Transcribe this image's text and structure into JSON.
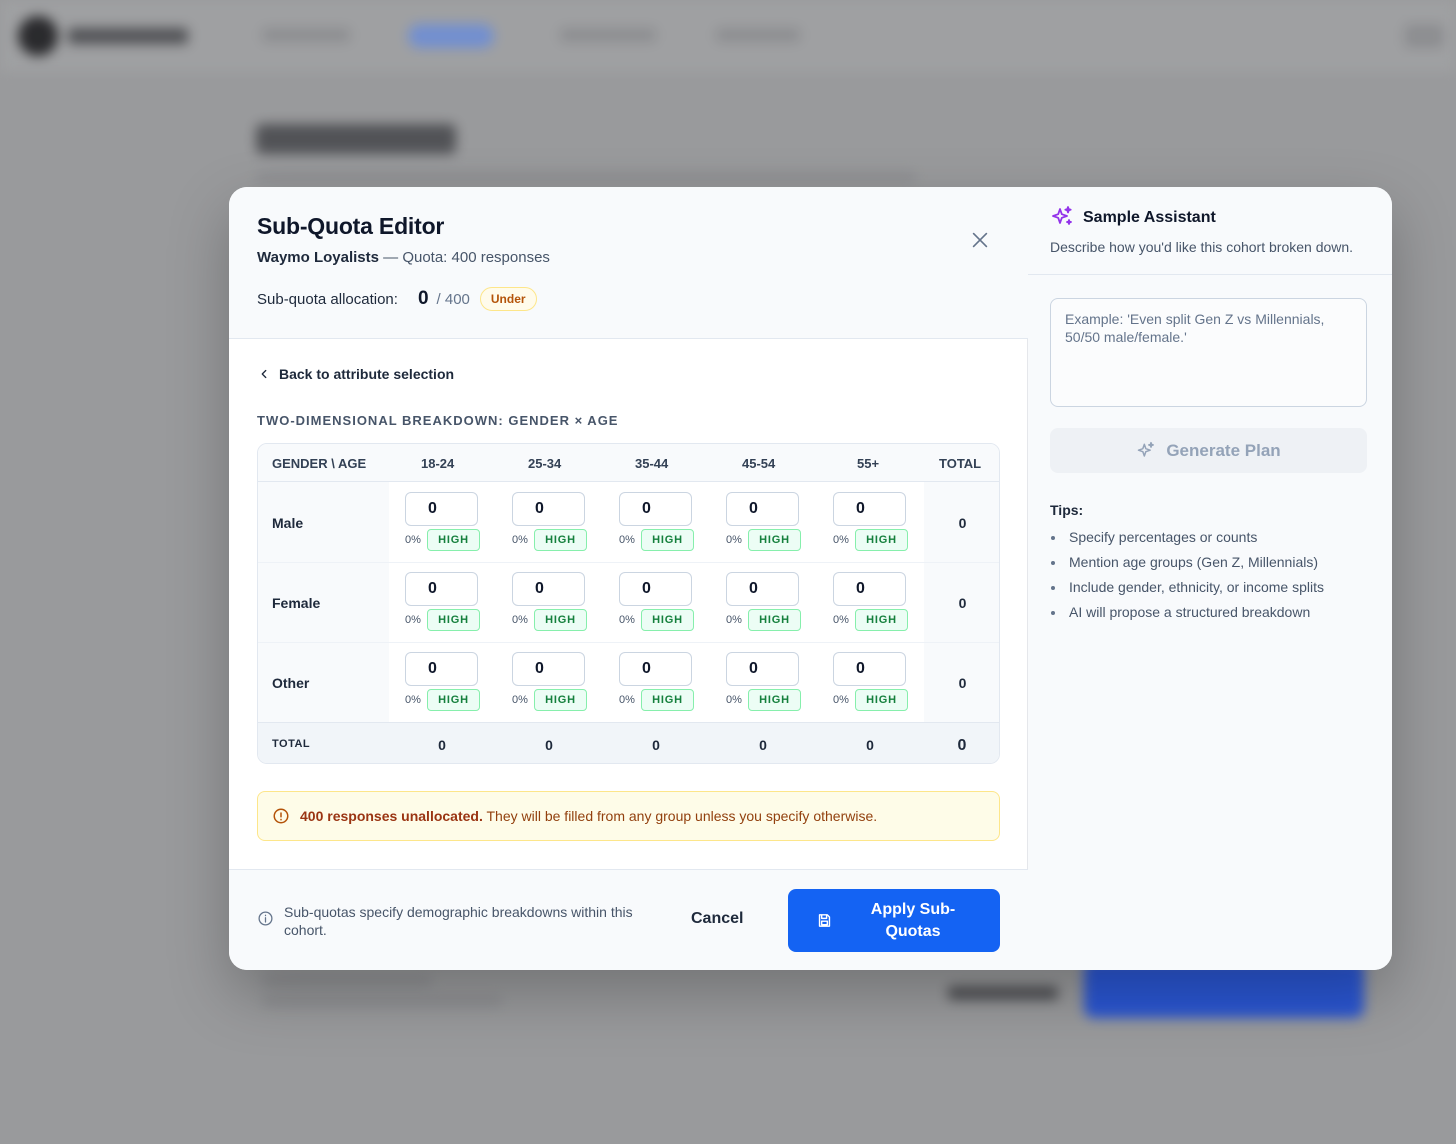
{
  "modal": {
    "title": "Sub-Quota Editor",
    "cohort_name": "Waymo Loyalists",
    "quota_text": "— Quota: 400 responses",
    "allocation_label": "Sub-quota allocation:",
    "allocation_count": "0",
    "allocation_total": "/ 400",
    "allocation_status": "Under",
    "back_label": "Back to attribute selection",
    "section_label": "TWO-DIMENSIONAL BREAKDOWN: GENDER × AGE",
    "grid": {
      "corner_header": "GENDER \\ AGE",
      "columns": [
        "18-24",
        "25-34",
        "35-44",
        "45-54",
        "55+"
      ],
      "total_header": "TOTAL",
      "rows": [
        {
          "label": "Male",
          "cells": [
            {
              "value": "0",
              "pct": "0%",
              "level": "HIGH"
            },
            {
              "value": "0",
              "pct": "0%",
              "level": "HIGH"
            },
            {
              "value": "0",
              "pct": "0%",
              "level": "HIGH"
            },
            {
              "value": "0",
              "pct": "0%",
              "level": "HIGH"
            },
            {
              "value": "0",
              "pct": "0%",
              "level": "HIGH"
            }
          ],
          "total": "0"
        },
        {
          "label": "Female",
          "cells": [
            {
              "value": "0",
              "pct": "0%",
              "level": "HIGH"
            },
            {
              "value": "0",
              "pct": "0%",
              "level": "HIGH"
            },
            {
              "value": "0",
              "pct": "0%",
              "level": "HIGH"
            },
            {
              "value": "0",
              "pct": "0%",
              "level": "HIGH"
            },
            {
              "value": "0",
              "pct": "0%",
              "level": "HIGH"
            }
          ],
          "total": "0"
        },
        {
          "label": "Other",
          "cells": [
            {
              "value": "0",
              "pct": "0%",
              "level": "HIGH"
            },
            {
              "value": "0",
              "pct": "0%",
              "level": "HIGH"
            },
            {
              "value": "0",
              "pct": "0%",
              "level": "HIGH"
            },
            {
              "value": "0",
              "pct": "0%",
              "level": "HIGH"
            },
            {
              "value": "0",
              "pct": "0%",
              "level": "HIGH"
            }
          ],
          "total": "0"
        }
      ],
      "totals_label": "TOTAL",
      "column_totals": [
        "0",
        "0",
        "0",
        "0",
        "0"
      ],
      "grand_total": "0"
    },
    "warning_bold": "400 responses unallocated.",
    "warning_text": "They will be filled from any group unless you specify otherwise.",
    "footer_info": "Sub-quotas specify demographic breakdowns within this cohort.",
    "cancel_label": "Cancel",
    "apply_label": "Apply Sub-Quotas"
  },
  "assistant": {
    "title": "Sample Assistant",
    "description": "Describe how you'd like this cohort broken down.",
    "placeholder": "Example: 'Even split Gen Z vs Millennials, 50/50 male/female.'",
    "generate_label": "Generate Plan",
    "tips_title": "Tips:",
    "tips": [
      "Specify percentages or counts",
      "Mention age groups (Gen Z, Millennials)",
      "Include gender, ethnicity, or income splits",
      "AI will propose a structured breakdown"
    ]
  },
  "colors": {
    "primary": "#1463f3",
    "sparkle": "#9333ea",
    "high_badge": "#15803d",
    "under_badge": "#b45309"
  }
}
